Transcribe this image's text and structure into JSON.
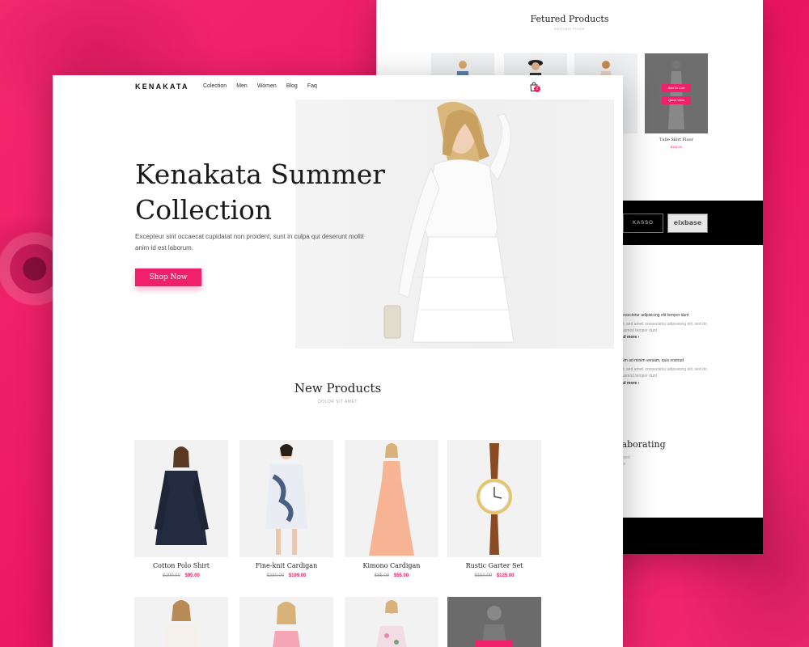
{
  "colors": {
    "accent": "#f0206a",
    "background": "#f0206a",
    "dark": "#000000"
  },
  "back_page": {
    "featured_title": "Fetured Products",
    "featured_subtitle": "EDITORS PICKS",
    "quick_actions": {
      "add_to_cart": "Add To Cart",
      "quick_view": "Quick View"
    },
    "highlight_product": {
      "name": "Tulle Skirt Floor",
      "price": "$115.00"
    },
    "brands": [
      "KASSO",
      "eixbase"
    ],
    "blog": [
      {
        "headline": "consectetur adipisicing elit tempor dunt",
        "text": "elit, sed amet, consectetur adipisicing elit, sed do eiusmod tempor dunt",
        "more": "ead more ›"
      },
      {
        "headline": "enim ad minim veniam, quis nostrud",
        "text": "elit, sed amet, consectetur adipisicing elit, sed do eiusmod tempor dunt",
        "more": "ead more ›"
      }
    ],
    "section_heading": "laborating",
    "section_small": [
      "onsed",
      "olor"
    ]
  },
  "header": {
    "logo": "KENAKATA",
    "nav": [
      "Colection",
      "Men",
      "Women",
      "Blog",
      "Faq"
    ],
    "cart_count": "2"
  },
  "hero": {
    "title_line1": "Kenakata Summer",
    "title_line2": "Collection",
    "text": "Excepteur sint occaecat cupidatat non proident, sunt in culpa qui deserunt mollit anim id est laborum.",
    "button": "Shop Now"
  },
  "new_products": {
    "title": "New Products",
    "subtitle": "DOLOR SIT AMET",
    "items": [
      {
        "name": "Cotton Polo Shirt",
        "old_price": "$100.00",
        "price": "$95.00"
      },
      {
        "name": "Fine-knit Cardigan",
        "old_price": "$230.00",
        "price": "$199.00"
      },
      {
        "name": "Kimono Cardigan",
        "old_price": "$85.00",
        "price": "$55.00"
      },
      {
        "name": "Rustic Garter Set",
        "old_price": "$150.00",
        "price": "$125.00"
      }
    ]
  }
}
